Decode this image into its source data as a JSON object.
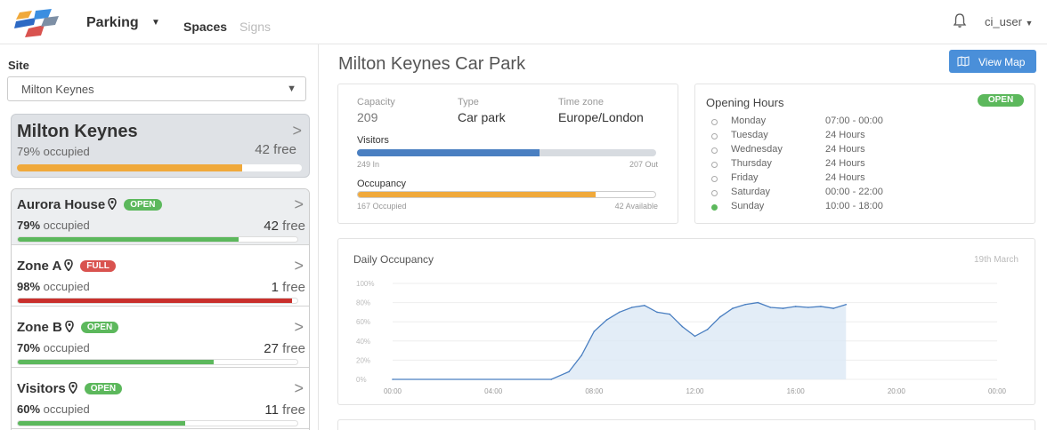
{
  "nav": {
    "title": "Parking",
    "tabs": [
      "Spaces",
      "Signs"
    ],
    "user": "ci_user"
  },
  "sidebar": {
    "site_label": "Site",
    "site_value": "Milton Keynes",
    "summary": {
      "name": "Milton Keynes",
      "occupied_text": "79% occupied",
      "free_text": "42 free",
      "fill": 0.79,
      "color": "#f0a93b"
    },
    "zones": [
      {
        "name": "Aurora House",
        "badge": "OPEN",
        "pct": "79%",
        "occ_suffix": " occupied",
        "free_num": "42",
        "free_suffix": " free",
        "fill": 0.79,
        "color": "#5cb85c"
      },
      {
        "name": "Zone A",
        "badge": "FULL",
        "pct": "98%",
        "occ_suffix": " occupied",
        "free_num": "1",
        "free_suffix": " free",
        "fill": 0.98,
        "color": "#c9302c"
      },
      {
        "name": "Zone B",
        "badge": "OPEN",
        "pct": "70%",
        "occ_suffix": " occupied",
        "free_num": "27",
        "free_suffix": " free",
        "fill": 0.7,
        "color": "#5cb85c"
      },
      {
        "name": "Visitors",
        "badge": "OPEN",
        "pct": "60%",
        "occ_suffix": " occupied",
        "free_num": "11",
        "free_suffix": " free",
        "fill": 0.6,
        "color": "#5cb85c"
      }
    ]
  },
  "main": {
    "title": "Milton Keynes Car Park",
    "view_map": "View Map",
    "stats": {
      "capacity_label": "Capacity",
      "capacity": "209",
      "type_label": "Type",
      "type": "Car park",
      "tz_label": "Time zone",
      "tz": "Europe/London",
      "visitors_label": "Visitors",
      "visitors_in": "249 In",
      "visitors_out": "207 Out",
      "visitors_fill": 0.61,
      "occupancy_label": "Occupancy",
      "occupied": "167 Occupied",
      "available": "42 Available",
      "occupancy_fill": 0.8
    },
    "hours": {
      "title": "Opening Hours",
      "status": "OPEN",
      "rows": [
        {
          "day": "Monday",
          "time": "07:00 - 00:00"
        },
        {
          "day": "Tuesday",
          "time": "24 Hours"
        },
        {
          "day": "Wednesday",
          "time": "24 Hours"
        },
        {
          "day": "Thursday",
          "time": "24 Hours"
        },
        {
          "day": "Friday",
          "time": "24 Hours"
        },
        {
          "day": "Saturday",
          "time": "00:00 - 22:00"
        },
        {
          "day": "Sunday",
          "time": "10:00 - 18:00",
          "active": true
        }
      ]
    }
  },
  "chart_data": {
    "type": "area",
    "title": "Daily Occupancy",
    "subtitle": "19th March",
    "x_ticks": [
      "00:00",
      "04:00",
      "08:00",
      "12:00",
      "16:00",
      "20:00",
      "00:00"
    ],
    "y_ticks": [
      "0%",
      "20%",
      "40%",
      "60%",
      "80%",
      "100%"
    ],
    "ylim": [
      0,
      100
    ],
    "xlim": [
      0,
      24
    ],
    "x": [
      0,
      6.3,
      7,
      7.5,
      8,
      8.5,
      9,
      9.5,
      10,
      10.5,
      11,
      11.5,
      12,
      12.5,
      13,
      13.5,
      14,
      14.5,
      15,
      15.5,
      16,
      16.5,
      17,
      17.5,
      18
    ],
    "values": [
      0,
      0,
      8,
      25,
      50,
      62,
      70,
      75,
      77,
      70,
      68,
      55,
      45,
      52,
      65,
      74,
      78,
      80,
      75,
      74,
      76,
      75,
      76,
      74,
      78
    ],
    "color": "#4a7fc1",
    "fill_color": "#dce8f5"
  }
}
